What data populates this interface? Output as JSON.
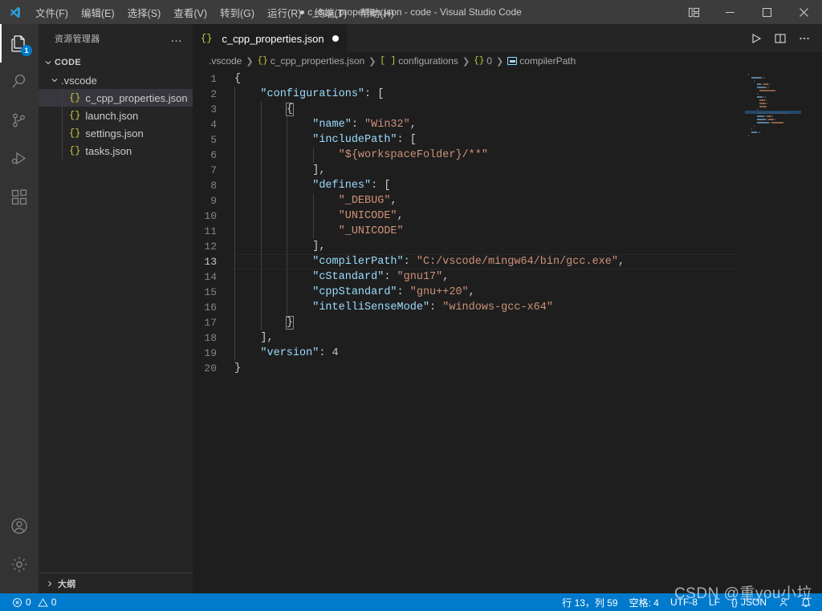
{
  "titlebar": {
    "logo_icon": "vscode-logo-icon",
    "menus": [
      {
        "label": "文件(F)",
        "name": "menu-file"
      },
      {
        "label": "编辑(E)",
        "name": "menu-edit"
      },
      {
        "label": "选择(S)",
        "name": "menu-selection"
      },
      {
        "label": "查看(V)",
        "name": "menu-view"
      },
      {
        "label": "转到(G)",
        "name": "menu-goto"
      },
      {
        "label": "运行(R)",
        "name": "menu-run"
      },
      {
        "label": "终端(T)",
        "name": "menu-terminal"
      },
      {
        "label": "帮助(H)",
        "name": "menu-help"
      }
    ],
    "window_title": "c_cpp_properties.json - code - Visual Studio Code",
    "dirty": true,
    "layout_icon": "customize-layout-icon",
    "minimize": "—",
    "maximize": "▢",
    "close": "✕",
    "bg_color": "#3c3c3c"
  },
  "activitybar": {
    "items": [
      {
        "name": "activity-explorer",
        "icon": "files-icon",
        "active": true,
        "badge": "1"
      },
      {
        "name": "activity-search",
        "icon": "search-icon",
        "active": false,
        "badge": ""
      },
      {
        "name": "activity-source-control",
        "icon": "source-control-icon",
        "active": false,
        "badge": ""
      },
      {
        "name": "activity-run-debug",
        "icon": "run-and-debug-icon",
        "active": false,
        "badge": ""
      },
      {
        "name": "activity-extensions",
        "icon": "extensions-icon",
        "active": false,
        "badge": ""
      }
    ],
    "bottom": [
      {
        "name": "activity-account",
        "icon": "account-icon"
      },
      {
        "name": "activity-settings",
        "icon": "gear-icon"
      }
    ],
    "bg_color": "#333333"
  },
  "sidebar": {
    "title": "资源管理器",
    "more_actions": "…",
    "tree": [
      {
        "label": "CODE",
        "level": "root",
        "type": "folder",
        "expanded": true,
        "selected": false
      },
      {
        "label": ".vscode",
        "level": "lvl1",
        "type": "folder",
        "expanded": true,
        "selected": false
      },
      {
        "label": "c_cpp_properties.json",
        "level": "lvl2",
        "type": "json",
        "expanded": null,
        "selected": true
      },
      {
        "label": "launch.json",
        "level": "lvl2",
        "type": "json",
        "expanded": null,
        "selected": false
      },
      {
        "label": "settings.json",
        "level": "lvl2",
        "type": "json",
        "expanded": null,
        "selected": false
      },
      {
        "label": "tasks.json",
        "level": "lvl2",
        "type": "json",
        "expanded": null,
        "selected": false
      }
    ],
    "outline_label": "大纲",
    "bg_color": "#252526",
    "selected_color": "#37373d"
  },
  "editor": {
    "tab": {
      "label": "c_cpp_properties.json",
      "icon": "{}",
      "dirty": true
    },
    "actions": [
      {
        "name": "run-code-button",
        "icon": "play-icon"
      },
      {
        "name": "split-editor-button",
        "icon": "split-editor-icon"
      },
      {
        "name": "more-actions-button",
        "icon": "ellipsis-icon"
      }
    ],
    "breadcrumb": [
      {
        "label": ".vscode",
        "icon": ""
      },
      {
        "label": "c_cpp_properties.json",
        "icon": "json-icon"
      },
      {
        "label": "configurations",
        "icon": "array-icon"
      },
      {
        "label": "0",
        "icon": "object-icon"
      },
      {
        "label": "compilerPath",
        "icon": "field-icon"
      }
    ],
    "active_line": 13,
    "lines": [
      {
        "n": 1,
        "guides": 0,
        "tokens": [
          {
            "t": "{",
            "c": "punct"
          }
        ]
      },
      {
        "n": 2,
        "guides": 1,
        "indent": 4,
        "tokens": [
          {
            "t": "\"configurations\"",
            "c": "key"
          },
          {
            "t": ": ",
            "c": "colon"
          },
          {
            "t": "[",
            "c": "punct"
          }
        ]
      },
      {
        "n": 3,
        "guides": 2,
        "indent": 8,
        "tokens": [
          {
            "t": "{",
            "c": "punct brace-match"
          }
        ]
      },
      {
        "n": 4,
        "guides": 3,
        "indent": 12,
        "tokens": [
          {
            "t": "\"name\"",
            "c": "key"
          },
          {
            "t": ": ",
            "c": "colon"
          },
          {
            "t": "\"Win32\"",
            "c": "str"
          },
          {
            "t": ",",
            "c": "punct"
          }
        ]
      },
      {
        "n": 5,
        "guides": 3,
        "indent": 12,
        "tokens": [
          {
            "t": "\"includePath\"",
            "c": "key"
          },
          {
            "t": ": ",
            "c": "colon"
          },
          {
            "t": "[",
            "c": "punct"
          }
        ]
      },
      {
        "n": 6,
        "guides": 4,
        "indent": 16,
        "tokens": [
          {
            "t": "\"${workspaceFolder}/**\"",
            "c": "str"
          }
        ]
      },
      {
        "n": 7,
        "guides": 3,
        "indent": 12,
        "tokens": [
          {
            "t": "],",
            "c": "punct"
          }
        ]
      },
      {
        "n": 8,
        "guides": 3,
        "indent": 12,
        "tokens": [
          {
            "t": "\"defines\"",
            "c": "key"
          },
          {
            "t": ": ",
            "c": "colon"
          },
          {
            "t": "[",
            "c": "punct"
          }
        ]
      },
      {
        "n": 9,
        "guides": 4,
        "indent": 16,
        "tokens": [
          {
            "t": "\"_DEBUG\"",
            "c": "str"
          },
          {
            "t": ",",
            "c": "punct"
          }
        ]
      },
      {
        "n": 10,
        "guides": 4,
        "indent": 16,
        "tokens": [
          {
            "t": "\"UNICODE\"",
            "c": "str"
          },
          {
            "t": ",",
            "c": "punct"
          }
        ]
      },
      {
        "n": 11,
        "guides": 4,
        "indent": 16,
        "tokens": [
          {
            "t": "\"_UNICODE\"",
            "c": "str"
          }
        ]
      },
      {
        "n": 12,
        "guides": 3,
        "indent": 12,
        "tokens": [
          {
            "t": "],",
            "c": "punct"
          }
        ]
      },
      {
        "n": 13,
        "guides": 3,
        "indent": 12,
        "tokens": [
          {
            "t": "\"compilerPath\"",
            "c": "key"
          },
          {
            "t": ": ",
            "c": "colon"
          },
          {
            "t": "\"C:/vscode/mingw64/bin/gcc.exe\"",
            "c": "str"
          },
          {
            "t": ",",
            "c": "punct"
          }
        ]
      },
      {
        "n": 14,
        "guides": 3,
        "indent": 12,
        "tokens": [
          {
            "t": "\"cStandard\"",
            "c": "key"
          },
          {
            "t": ": ",
            "c": "colon"
          },
          {
            "t": "\"gnu17\"",
            "c": "str"
          },
          {
            "t": ",",
            "c": "punct"
          }
        ]
      },
      {
        "n": 15,
        "guides": 3,
        "indent": 12,
        "tokens": [
          {
            "t": "\"cppStandard\"",
            "c": "key"
          },
          {
            "t": ": ",
            "c": "colon"
          },
          {
            "t": "\"gnu++20\"",
            "c": "str"
          },
          {
            "t": ",",
            "c": "punct"
          }
        ]
      },
      {
        "n": 16,
        "guides": 3,
        "indent": 12,
        "tokens": [
          {
            "t": "\"intelliSenseMode\"",
            "c": "key"
          },
          {
            "t": ": ",
            "c": "colon"
          },
          {
            "t": "\"windows-gcc-x64\"",
            "c": "str"
          }
        ]
      },
      {
        "n": 17,
        "guides": 2,
        "indent": 8,
        "tokens": [
          {
            "t": "}",
            "c": "punct brace-match"
          }
        ]
      },
      {
        "n": 18,
        "guides": 1,
        "indent": 4,
        "tokens": [
          {
            "t": "],",
            "c": "punct"
          }
        ]
      },
      {
        "n": 19,
        "guides": 1,
        "indent": 4,
        "tokens": [
          {
            "t": "\"version\"",
            "c": "key"
          },
          {
            "t": ": ",
            "c": "colon"
          },
          {
            "t": "4",
            "c": "num"
          }
        ]
      },
      {
        "n": 20,
        "guides": 0,
        "indent": 0,
        "tokens": [
          {
            "t": "}",
            "c": "punct"
          }
        ]
      }
    ]
  },
  "statusbar": {
    "errors_icon": "error-icon",
    "errors": "0",
    "warnings_icon": "warning-icon",
    "warnings": "0",
    "cursor_position": "行 13，列 59",
    "indentation": "空格: 4",
    "encoding": "UTF-8",
    "eol": "LF",
    "language_icon": "{}",
    "language": "JSON",
    "feedback_icon": "smiley-icon",
    "notifications_icon": "bell-icon",
    "bg_color": "#007acc"
  },
  "watermark": "CSDN @重you小垃"
}
